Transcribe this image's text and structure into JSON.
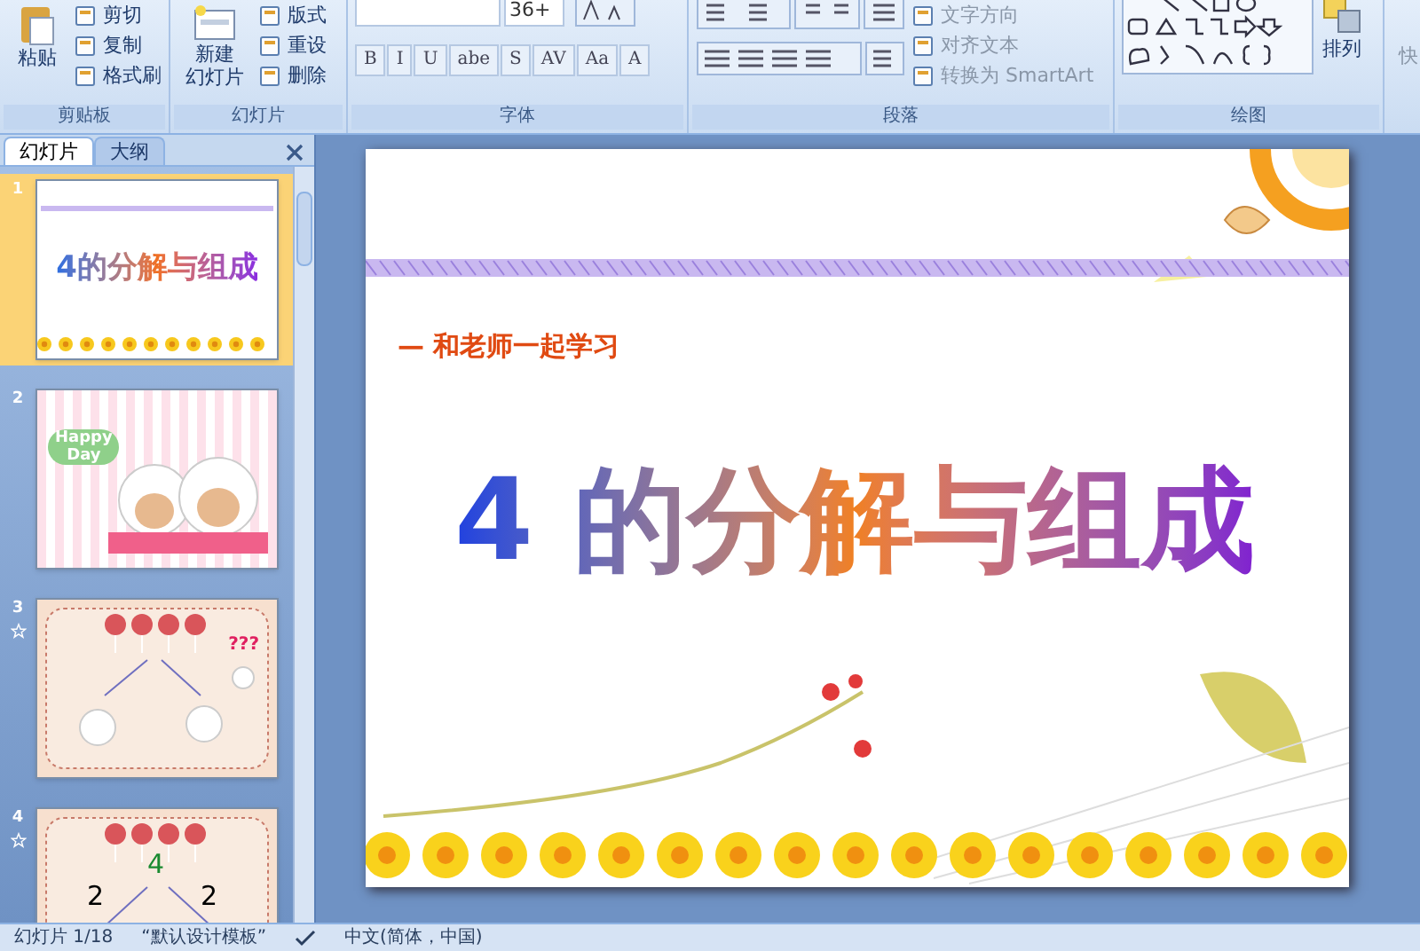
{
  "ribbon": {
    "groups": [
      {
        "label": "剪贴板",
        "kind": "clipboard",
        "large": {
          "label": "粘贴"
        },
        "small": [
          "剪切",
          "复制",
          "格式刷"
        ]
      },
      {
        "label": "幻灯片",
        "kind": "slides",
        "large": {
          "lines": [
            "新建",
            "幻灯片"
          ]
        },
        "small": [
          "版式",
          "重设",
          "删除"
        ]
      },
      {
        "label": "字体",
        "kind": "font",
        "font_size": "36+",
        "format_buttons": [
          "B",
          "I",
          "U",
          "abe",
          "S",
          "AV",
          "Aa",
          "A"
        ]
      },
      {
        "label": "段落",
        "kind": "paragraph",
        "small": [
          "文字方向",
          "对齐文本",
          "转换为 SmartArt"
        ]
      },
      {
        "label": "绘图",
        "kind": "drawing",
        "large": {
          "label": "排列"
        }
      }
    ],
    "cut_group_label": "快"
  },
  "slides_panel": {
    "tabs": [
      {
        "label": "幻灯片",
        "selected": true
      },
      {
        "label": "大纲",
        "selected": false
      }
    ],
    "thumbnails": [
      {
        "number": "1",
        "selected": true,
        "animated": false,
        "kind": "title",
        "texts": [
          "4的分解与组成"
        ]
      },
      {
        "number": "2",
        "selected": false,
        "animated": false,
        "kind": "cartoon",
        "texts": [
          "Happy",
          "Day"
        ]
      },
      {
        "number": "3",
        "selected": false,
        "animated": true,
        "kind": "question",
        "texts": [
          "???"
        ]
      },
      {
        "number": "4",
        "selected": false,
        "animated": true,
        "kind": "split",
        "texts": [
          "4",
          "2",
          "2"
        ]
      }
    ]
  },
  "slide": {
    "subtitle": "— 和老师一起学习",
    "title": "4 的分解与组成"
  },
  "status_bar": {
    "slide_position": "幻灯片 1/18",
    "theme": "“默认设计模板”",
    "language": "中文(简体，中国)"
  }
}
